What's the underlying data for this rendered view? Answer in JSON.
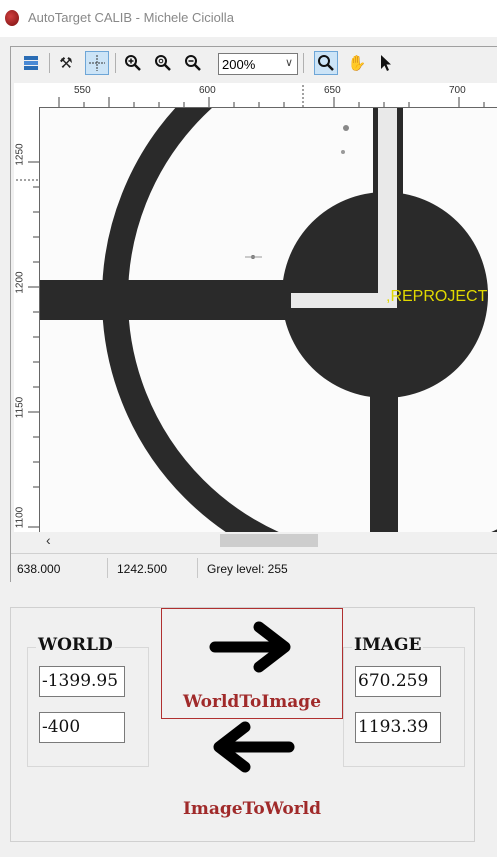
{
  "window": {
    "title": "AutoTarget CALIB - Michele Ciciolla"
  },
  "toolbar": {
    "zoom_value": "200%"
  },
  "ruler": {
    "x_ticks": [
      "550",
      "600",
      "650",
      "700"
    ],
    "y_ticks": [
      "1250",
      "1200",
      "1150",
      "1100"
    ]
  },
  "canvas": {
    "overlay_text": ",REPROJECT"
  },
  "status": {
    "x": "638.000",
    "y": "1242.500",
    "grey": "Grey level: 255"
  },
  "world": {
    "title": "WORLD",
    "x_value": "-1399.95",
    "y_value": "-400"
  },
  "image": {
    "title": "IMAGE",
    "x_value": "670.259",
    "y_value": "1193.39"
  },
  "buttons": {
    "world_to_image": "WorldToImage",
    "image_to_world": "ImageToWorld"
  },
  "colors": {
    "accent_red": "#a02a2a",
    "overlay_yellow": "#e0d800",
    "target_dark": "#2a2a2a"
  }
}
